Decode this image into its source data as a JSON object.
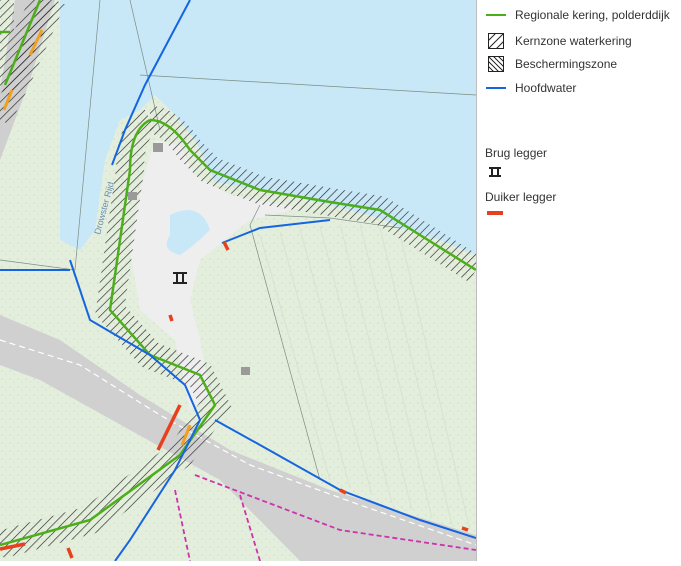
{
  "legend": {
    "items": [
      {
        "label": "Regionale kering, polderddijk",
        "icon": "green-line-icon",
        "color": "#4caf1a"
      },
      {
        "label": "Kernzone waterkering",
        "icon": "diagonal-hatch-icon"
      },
      {
        "label": "Beschermingszone",
        "icon": "cross-hatch-icon"
      },
      {
        "label": "Hoofdwater",
        "icon": "blue-line-icon",
        "color": "#1565e0"
      }
    ],
    "brug_title": "Brug legger",
    "brug_icon": "bridge-icon",
    "duiker_title": "Duiker legger",
    "duiker_icon": "culvert-icon",
    "duiker_color": "#e8401c"
  },
  "map": {
    "water_label": "Drowster Rijd",
    "colors": {
      "water": "#c8e8f8",
      "land": "#e6efe0",
      "dike_green": "#4caf1a",
      "hoofdwater": "#1565e0",
      "duiker": "#e8401c",
      "pink_track": "#cc33aa",
      "road": "#b8b8b8"
    }
  }
}
